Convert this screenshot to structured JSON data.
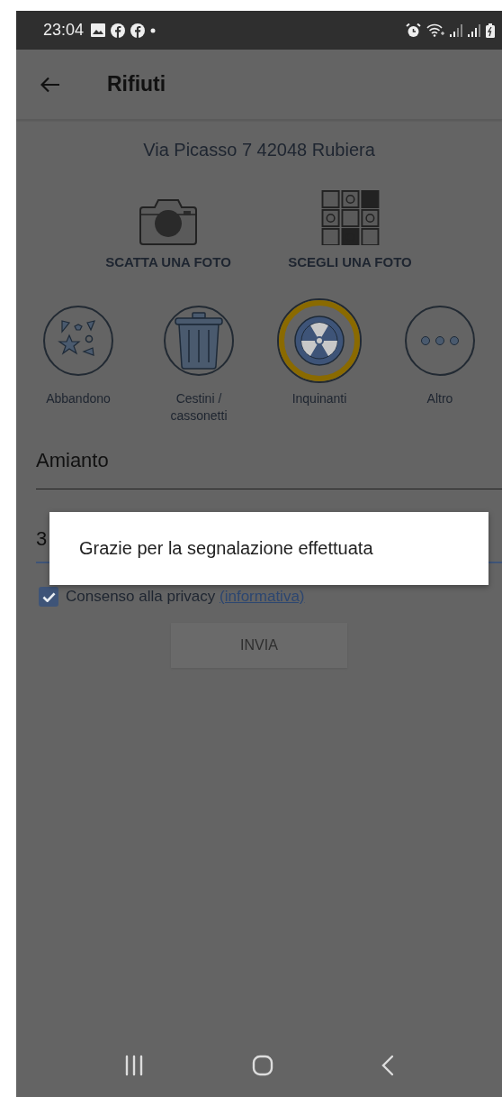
{
  "status_bar": {
    "time": "23:04"
  },
  "app_bar": {
    "title": "Rifiuti"
  },
  "address": "Via Picasso 7 42048 Rubiera",
  "photo_actions": [
    {
      "kind": "camera",
      "label": "SCATTA UNA FOTO"
    },
    {
      "kind": "gallery",
      "label": "SCEGLI UNA FOTO"
    }
  ],
  "categories": [
    {
      "kind": "debris",
      "label": "Abbandono",
      "selected": false
    },
    {
      "kind": "bin",
      "label": "Cestini / cassonetti",
      "selected": false
    },
    {
      "kind": "hazard",
      "label": "Inquinanti",
      "selected": true
    },
    {
      "kind": "more",
      "label": "Altro",
      "selected": false
    }
  ],
  "fields": [
    {
      "value": "Amianto",
      "focused": false
    },
    {
      "value": "3",
      "focused": true
    }
  ],
  "privacy": {
    "checked": true,
    "text": "Consenso alla privacy",
    "link": "(informativa)"
  },
  "submit": {
    "label": "INVIA",
    "disabled": true
  },
  "dialog": {
    "message": "Grazie per la segnalazione effettuata"
  }
}
